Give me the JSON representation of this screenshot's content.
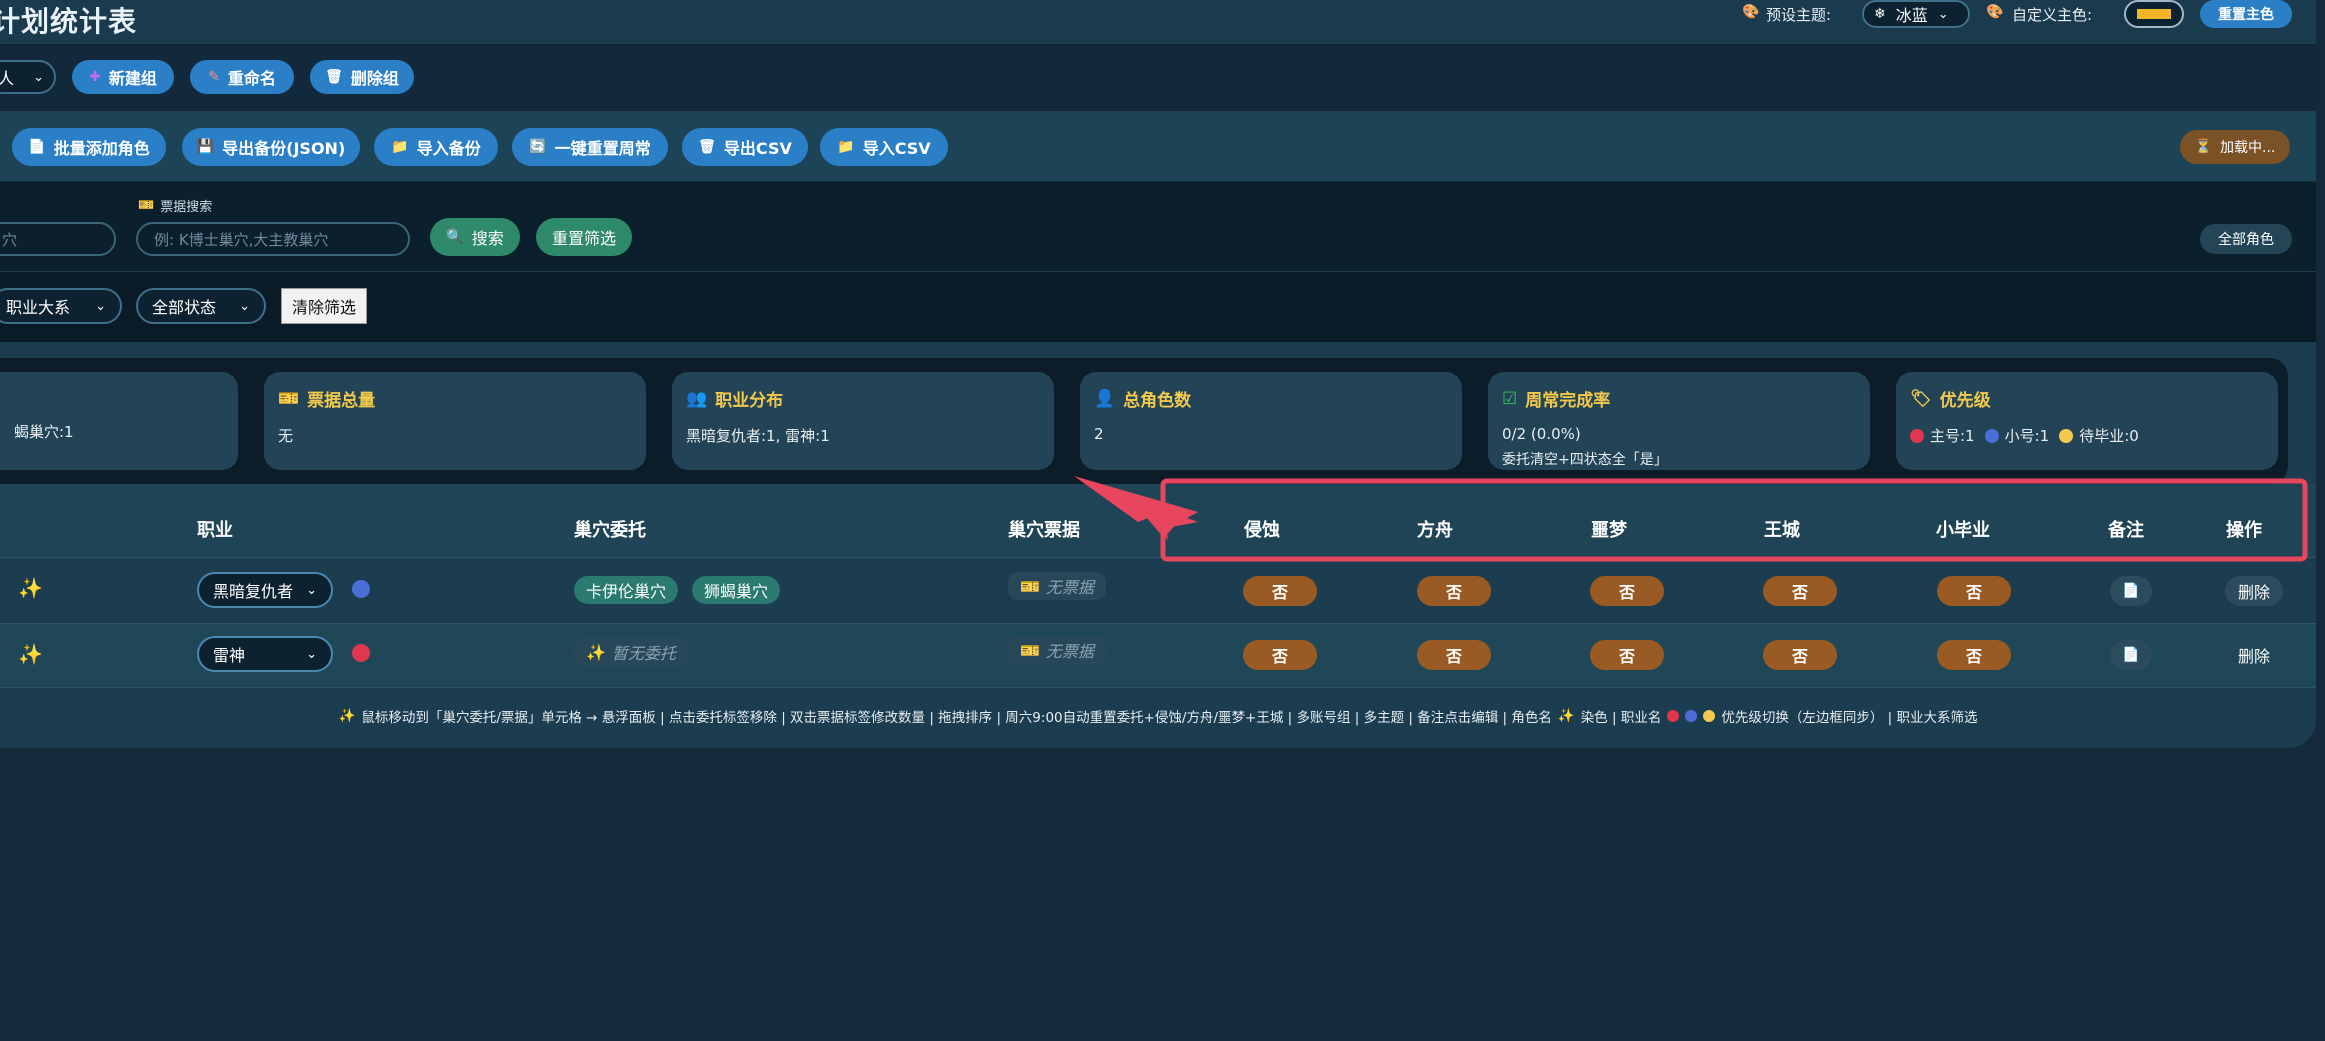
{
  "header": {
    "title": "计划统计表",
    "preset_theme_label": "预设主题:",
    "preset_theme_value": "冰蓝",
    "custom_color_label": "自定义主色:",
    "custom_color_value": "#f5b529",
    "reset_color_label": "重置主色"
  },
  "group_bar": {
    "group_select_value": "人",
    "new_group": "新建组",
    "rename": "重命名",
    "delete_group": "删除组"
  },
  "toolbar": {
    "batch_add": "批量添加角色",
    "export_json": "导出备份(JSON)",
    "import_backup": "导入备份",
    "reset_weekly": "一键重置周常",
    "export_csv": "导出CSV",
    "import_csv": "导入CSV",
    "loading": "加载中..."
  },
  "search": {
    "left_input_fragment": "穴",
    "ticket_label": "票据搜索",
    "ticket_placeholder": "例: K博士巢穴,大主教巢穴",
    "search_button": "搜索",
    "reset_filter": "重置筛选",
    "all_roles": "全部角色"
  },
  "filters": {
    "job_system": "职业大系",
    "all_status": "全部状态",
    "clear": "清除筛选"
  },
  "stats": [
    {
      "title": "",
      "body": "蝎巢穴:1"
    },
    {
      "title": "票据总量",
      "body": "无"
    },
    {
      "title": "职业分布",
      "body": "黑暗复仇者:1, 雷神:1"
    },
    {
      "title": "总角色数",
      "body": "2"
    },
    {
      "title": "周常完成率",
      "body": "0/2 (0.0%)",
      "sub": "委托清空+四状态全「是」"
    },
    {
      "title": "优先级",
      "main": "主号:1",
      "alt": "小号:1",
      "pending": "待毕业:0"
    }
  ],
  "table": {
    "headers": {
      "job": "职业",
      "nest_commission": "巢穴委托",
      "nest_ticket": "巢穴票据",
      "erosion": "侵蚀",
      "ark": "方舟",
      "nightmare": "噩梦",
      "royal": "王城",
      "grad": "小毕业",
      "note": "备注",
      "action": "操作"
    },
    "rows": [
      {
        "job": "黑暗复仇者",
        "priority_color": "#4a6fd6",
        "tags": [
          "卡伊伦巢穴",
          "狮蝎巢穴"
        ],
        "commission_empty": "",
        "ticket": "无票据",
        "states": [
          "否",
          "否",
          "否",
          "否",
          "否"
        ],
        "delete": "删除"
      },
      {
        "job": "雷神",
        "priority_color": "#e0364f",
        "tags": [],
        "commission_empty": "暂无委托",
        "ticket": "无票据",
        "states": [
          "否",
          "否",
          "否",
          "否",
          "否"
        ],
        "delete": "删除"
      }
    ]
  },
  "footer": {
    "hint_a": "鼠标移动到「巢穴委托/票据」单元格 → 悬浮面板 | 点击委托标签移除 | 双击票据标签修改数量 | 拖拽排序 | 周六9:00自动重置委托+侵蚀/方舟/噩梦+王城 | 多账号组 | 多主题 | 备注点击编辑 | 角色名",
    "hint_b": "染色 | 职业名",
    "hint_c": "优先级切换（左边框同步） | 职业大系筛选"
  },
  "colors": {
    "accent": "#2a7fc6",
    "no_state": "#9a5a23",
    "highlight": "#e8455f",
    "tag": "#2a7a70"
  }
}
